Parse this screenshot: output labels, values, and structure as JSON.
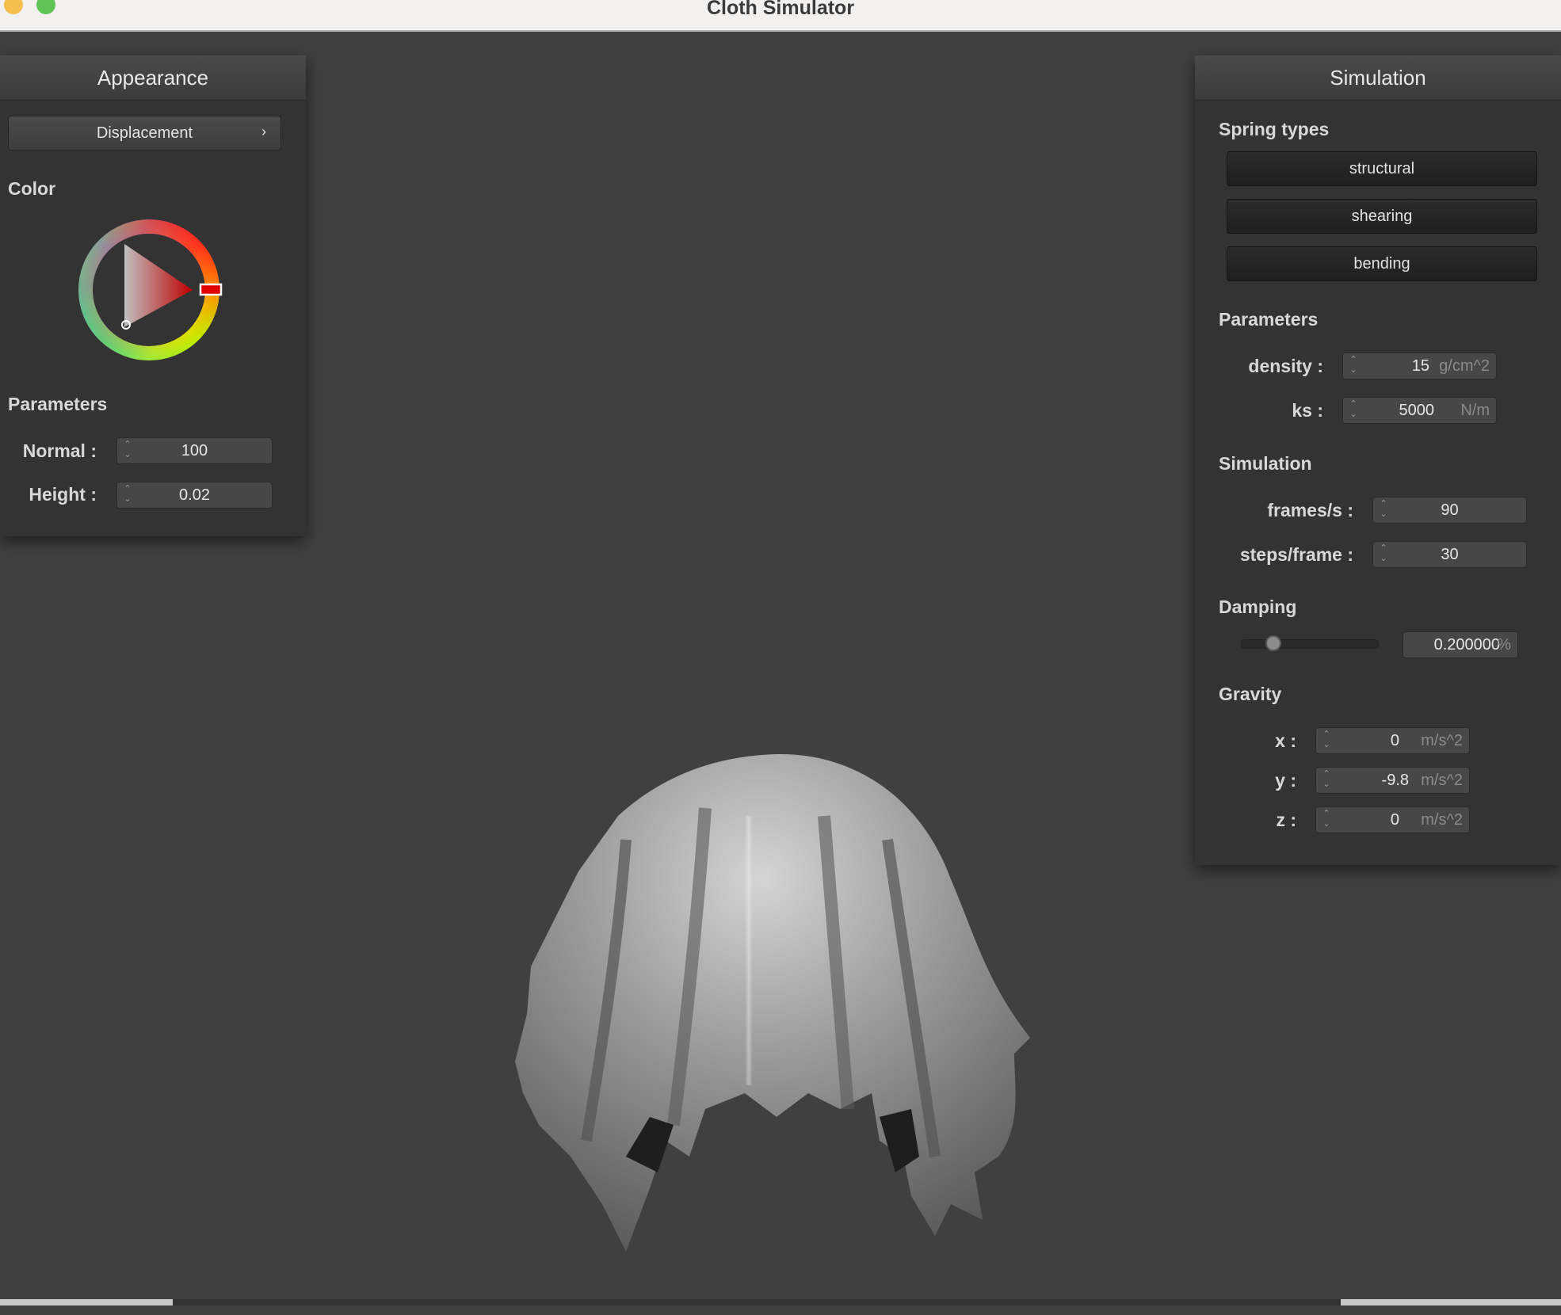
{
  "window": {
    "title": "Cloth Simulator"
  },
  "appearance": {
    "title": "Appearance",
    "shader_button": "Displacement",
    "color_label": "Color",
    "selected_color": "#ff0000",
    "parameters_label": "Parameters",
    "normal": {
      "label": "Normal :",
      "value": "100"
    },
    "height": {
      "label": "Height :",
      "value": "0.02"
    }
  },
  "simulation": {
    "title": "Simulation",
    "spring_types_label": "Spring types",
    "springs": [
      "structural",
      "shearing",
      "bending"
    ],
    "parameters_label": "Parameters",
    "density": {
      "label": "density :",
      "value": "15",
      "unit": "g/cm^2"
    },
    "ks": {
      "label": "ks :",
      "value": "5000",
      "unit": "N/m"
    },
    "simulation_label": "Simulation",
    "fps": {
      "label": "frames/s :",
      "value": "90"
    },
    "steps": {
      "label": "steps/frame :",
      "value": "30"
    },
    "damping_label": "Damping",
    "damping": {
      "value": "0.200000",
      "unit": "%",
      "slider_fraction": 0.2
    },
    "gravity_label": "Gravity",
    "gx": {
      "label": "x :",
      "value": "0",
      "unit": "m/s^2"
    },
    "gy": {
      "label": "y :",
      "value": "-9.8",
      "unit": "m/s^2"
    },
    "gz": {
      "label": "z :",
      "value": "0",
      "unit": "m/s^2"
    }
  }
}
